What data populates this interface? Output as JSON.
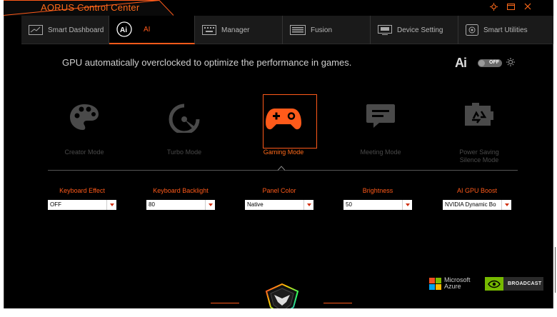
{
  "app": {
    "title": "AORUS Control Center"
  },
  "window_controls": [
    {
      "name": "settings-icon",
      "glyph": "☼"
    },
    {
      "name": "restore-icon",
      "glyph": "▭"
    },
    {
      "name": "close-icon",
      "glyph": "✕"
    }
  ],
  "nav": {
    "tabs": [
      {
        "label": "Smart Dashboard",
        "icon": "dashboard-icon",
        "active": false
      },
      {
        "label": "AI",
        "icon": "ai-icon",
        "active": true
      },
      {
        "label": "Manager",
        "icon": "keyboard-manager-icon",
        "active": false
      },
      {
        "label": "Fusion",
        "icon": "keyboard-fusion-icon",
        "active": false
      },
      {
        "label": "Device Setting",
        "icon": "monitor-icon",
        "active": false
      },
      {
        "label": "Smart Utilities",
        "icon": "utilities-icon",
        "active": false
      }
    ]
  },
  "main": {
    "headline": "GPU automatically overclocked to optimize the performance in games.",
    "ai_logo": "Ai",
    "ai_toggle": {
      "state": "OFF"
    },
    "modes": [
      {
        "label": "Creator Mode",
        "icon": "palette-icon",
        "active": false
      },
      {
        "label": "Turbo Mode",
        "icon": "speedometer-icon",
        "active": false
      },
      {
        "label": "Gaming Mode",
        "icon": "gamepad-icon",
        "active": true
      },
      {
        "label": "Meeting Mode",
        "icon": "chat-icon",
        "active": false
      },
      {
        "label": "Power Saving\nSilence Mode",
        "icon": "battery-recycle-icon",
        "active": false
      }
    ],
    "settings": [
      {
        "label": "Keyboard Effect",
        "value": "OFF"
      },
      {
        "label": "Keyboard Backlight",
        "value": "80"
      },
      {
        "label": "Panel Color",
        "value": "Native"
      },
      {
        "label": "Brightness",
        "value": "50"
      },
      {
        "label": "AI GPU Boost",
        "value": "NVIDIA Dynamic Bo"
      }
    ]
  },
  "partners": {
    "microsoft_line1": "Microsoft",
    "microsoft_line2": "Azure",
    "broadcast": "BROADCAST"
  },
  "colors": {
    "accent": "#ff5a1a",
    "background": "#000000"
  }
}
